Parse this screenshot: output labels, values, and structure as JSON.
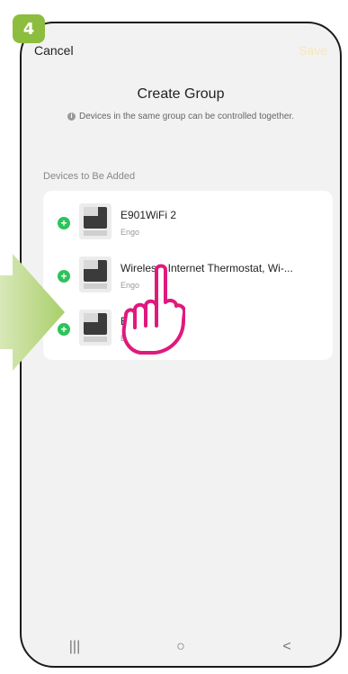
{
  "step": {
    "number": "4"
  },
  "header": {
    "cancel_label": "Cancel",
    "save_label": "Save"
  },
  "page": {
    "title": "Create Group",
    "subtitle": "Devices in the same group can be controlled together."
  },
  "section": {
    "label": "Devices to Be Added"
  },
  "devices": [
    {
      "name": "E901WiFi 2",
      "brand": "Engo"
    },
    {
      "name": "Wireless, Internet Thermostat, Wi-...",
      "brand": "Engo"
    },
    {
      "name": "E",
      "brand": "En"
    }
  ],
  "navbar": {
    "recent": "|||",
    "home": "○",
    "back": "<"
  },
  "colors": {
    "badge": "#8cbd3e",
    "add": "#2ec35a",
    "hand": "#e0197d",
    "arrow": "#c4dc8e"
  }
}
